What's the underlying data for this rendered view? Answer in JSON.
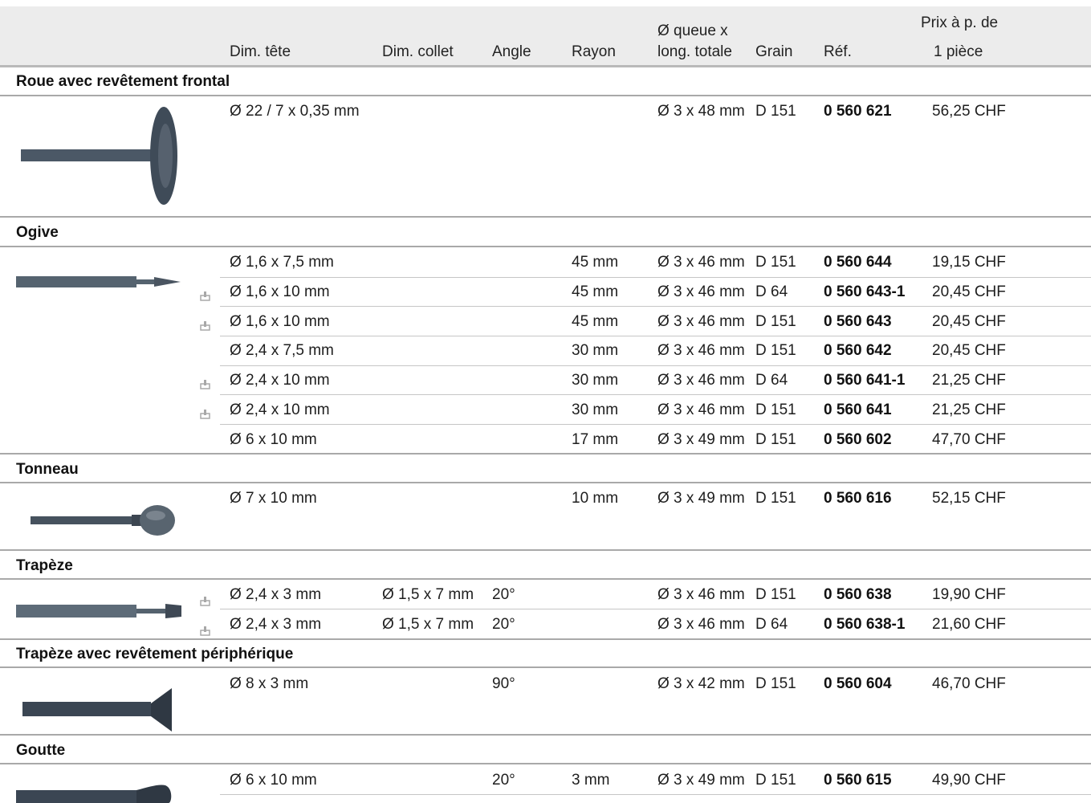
{
  "headers": {
    "dim_tete": "Dim. tête",
    "dim_collet": "Dim. collet",
    "angle": "Angle",
    "rayon": "Rayon",
    "queue_line1": "Ø queue x",
    "queue_line2": "long. totale",
    "grain": "Grain",
    "ref": "Réf.",
    "prix_line1": "Prix à p. de",
    "prix_line2": "1 pièce"
  },
  "sections": [
    {
      "title": "Roue avec revêtement frontal",
      "rows": [
        {
          "dim_tete": "Ø 22 / 7 x 0,35 mm",
          "dim_collet": "",
          "angle": "",
          "rayon": "",
          "queue": "Ø 3 x 48 mm",
          "grain": "D 151",
          "ref": "0 560 621",
          "prix": "56,25 CHF",
          "marker": false
        }
      ]
    },
    {
      "title": "Ogive",
      "rows": [
        {
          "dim_tete": "Ø 1,6 x 7,5 mm",
          "dim_collet": "",
          "angle": "",
          "rayon": "45 mm",
          "queue": "Ø 3 x 46 mm",
          "grain": "D 151",
          "ref": "0 560 644",
          "prix": "19,15 CHF",
          "marker": false
        },
        {
          "dim_tete": "Ø 1,6 x 10 mm",
          "dim_collet": "",
          "angle": "",
          "rayon": "45 mm",
          "queue": "Ø 3 x 46 mm",
          "grain": "D 64",
          "ref": "0 560 643-1",
          "prix": "20,45 CHF",
          "marker": true
        },
        {
          "dim_tete": "Ø 1,6 x 10 mm",
          "dim_collet": "",
          "angle": "",
          "rayon": "45 mm",
          "queue": "Ø 3 x 46 mm",
          "grain": "D 151",
          "ref": "0 560 643",
          "prix": "20,45 CHF",
          "marker": true
        },
        {
          "dim_tete": "Ø 2,4 x 7,5 mm",
          "dim_collet": "",
          "angle": "",
          "rayon": "30 mm",
          "queue": "Ø 3 x 46 mm",
          "grain": "D 151",
          "ref": "0 560 642",
          "prix": "20,45 CHF",
          "marker": false
        },
        {
          "dim_tete": "Ø 2,4 x 10 mm",
          "dim_collet": "",
          "angle": "",
          "rayon": "30 mm",
          "queue": "Ø 3 x 46 mm",
          "grain": "D 64",
          "ref": "0 560 641-1",
          "prix": "21,25 CHF",
          "marker": true
        },
        {
          "dim_tete": "Ø 2,4 x 10 mm",
          "dim_collet": "",
          "angle": "",
          "rayon": "30 mm",
          "queue": "Ø 3 x 46 mm",
          "grain": "D 151",
          "ref": "0 560 641",
          "prix": "21,25 CHF",
          "marker": true
        },
        {
          "dim_tete": "Ø 6 x 10 mm",
          "dim_collet": "",
          "angle": "",
          "rayon": "17 mm",
          "queue": "Ø 3 x 49 mm",
          "grain": "D 151",
          "ref": "0 560 602",
          "prix": "47,70 CHF",
          "marker": false
        }
      ]
    },
    {
      "title": "Tonneau",
      "rows": [
        {
          "dim_tete": "Ø 7 x 10 mm",
          "dim_collet": "",
          "angle": "",
          "rayon": "10 mm",
          "queue": "Ø 3 x 49 mm",
          "grain": "D 151",
          "ref": "0 560 616",
          "prix": "52,15 CHF",
          "marker": false
        }
      ]
    },
    {
      "title": "Trapèze",
      "rows": [
        {
          "dim_tete": "Ø 2,4 x 3 mm",
          "dim_collet": "Ø 1,5 x 7 mm",
          "angle": "20°",
          "rayon": "",
          "queue": "Ø 3 x 46 mm",
          "grain": "D 151",
          "ref": "0 560 638",
          "prix": "19,90 CHF",
          "marker": true
        },
        {
          "dim_tete": "Ø 2,4 x 3 mm",
          "dim_collet": "Ø 1,5 x 7 mm",
          "angle": "20°",
          "rayon": "",
          "queue": "Ø 3 x 46 mm",
          "grain": "D 64",
          "ref": "0 560 638-1",
          "prix": "21,60 CHF",
          "marker": true
        }
      ]
    },
    {
      "title": "Trapèze avec revêtement périphérique",
      "rows": [
        {
          "dim_tete": "Ø 8 x 3 mm",
          "dim_collet": "",
          "angle": "90°",
          "rayon": "",
          "queue": "Ø 3 x 42 mm",
          "grain": "D 151",
          "ref": "0 560 604",
          "prix": "46,70 CHF",
          "marker": false
        }
      ]
    },
    {
      "title": "Goutte",
      "rows": [
        {
          "dim_tete": "Ø 6 x 10 mm",
          "dim_collet": "",
          "angle": "20°",
          "rayon": "3 mm",
          "queue": "Ø 3 x 49 mm",
          "grain": "D 151",
          "ref": "0 560 615",
          "prix": "49,90 CHF",
          "marker": false
        }
      ]
    }
  ],
  "colors": {
    "header_bg": "#ececec",
    "rule": "#a9a9a9",
    "tool": "#4b5866",
    "marker": "#a8a8a8"
  },
  "icons": {
    "row_marker": "sample-marker-icon"
  }
}
